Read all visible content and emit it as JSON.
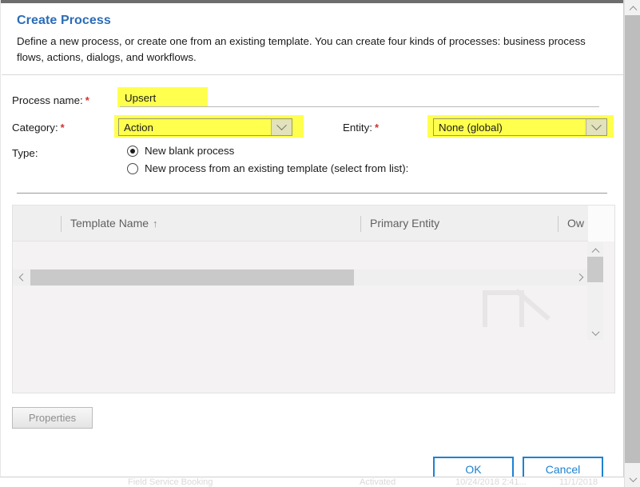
{
  "dialog": {
    "title": "Create Process",
    "description": "Define a new process, or create one from an existing template. You can create four kinds of processes: business process flows, actions, dialogs, and workflows.",
    "required_marker": "*"
  },
  "form": {
    "process_name": {
      "label": "Process name:",
      "value": "Upsert",
      "placeholder": "",
      "required": true,
      "highlighted": true
    },
    "category": {
      "label": "Category:",
      "value": "Action",
      "required": true,
      "highlighted": true
    },
    "entity": {
      "label": "Entity:",
      "value": "None (global)",
      "required": true,
      "highlighted": true
    },
    "type": {
      "label": "Type:",
      "options": [
        {
          "label": "New blank process",
          "selected": true
        },
        {
          "label": "New process from an existing template (select from list):",
          "selected": false
        }
      ]
    }
  },
  "grid": {
    "columns": [
      {
        "label": "Template Name",
        "sort": "↑"
      },
      {
        "label": "Primary Entity",
        "sort": ""
      },
      {
        "label": "Ow",
        "sort": ""
      }
    ],
    "rows": []
  },
  "buttons": {
    "properties": "Properties",
    "ok": "OK",
    "cancel": "Cancel"
  },
  "icons": {
    "chevron_down": "chevron-down-icon",
    "chevron_up": "chevron-up-icon",
    "chevron_left": "chevron-left-icon",
    "chevron_right": "chevron-right-icon",
    "sort_ascending": "sort-ascending-icon"
  },
  "colors": {
    "title_blue": "#2b6cb8",
    "button_blue": "#1c82d2",
    "highlight_yellow": "#ffff4d",
    "required_red": "#d03030"
  },
  "background_page": {
    "row_text": {
      "col1": "Field Service Booking",
      "col2": "Activated",
      "col3": "10/24/2018 2:41...",
      "col4": "11/1/2018"
    }
  }
}
